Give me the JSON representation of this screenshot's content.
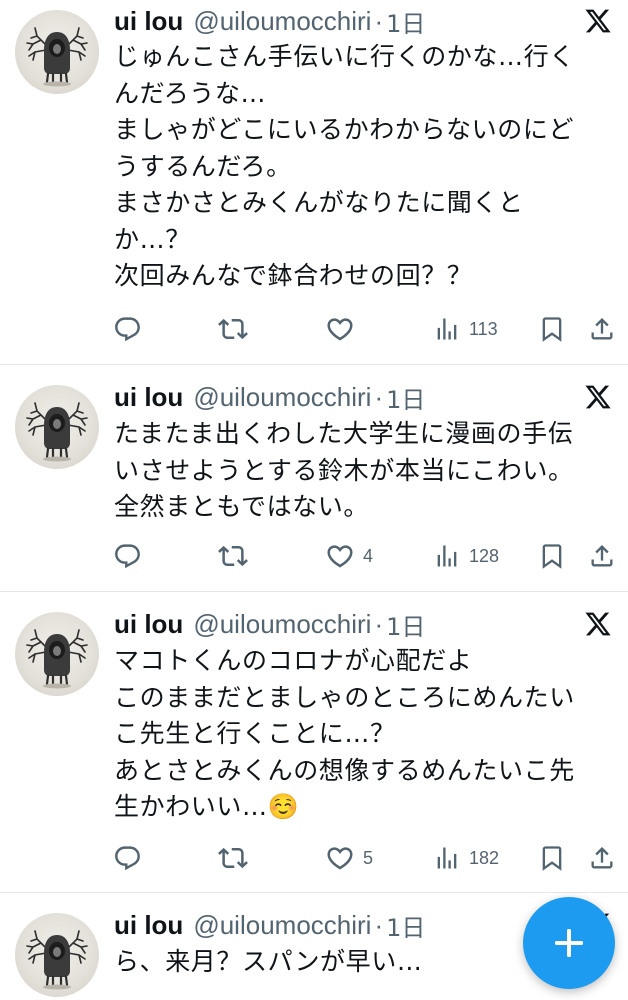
{
  "tweets": [
    {
      "name": "ui lou",
      "handle": "@uiloumocchiri",
      "time": "1日",
      "lines": [
        "じゅんこさん手伝いに行くのかな…行く",
        "んだろうな…",
        "ましゃがどこにいるかわからないのにど",
        "うするんだろ。",
        "まさかさとみくんがなりたに聞くと",
        "か…？",
        "次回みんなで鉢合わせの回？？"
      ],
      "likes": "",
      "views": "113"
    },
    {
      "name": "ui lou",
      "handle": "@uiloumocchiri",
      "time": "1日",
      "lines": [
        "たまたま出くわした大学生に漫画の手伝",
        "いさせようとする鈴木が本当にこわい。",
        "全然まともではない。"
      ],
      "likes": "4",
      "views": "128"
    },
    {
      "name": "ui lou",
      "handle": "@uiloumocchiri",
      "time": "1日",
      "lines": [
        "マコトくんのコロナが心配だよ",
        "このままだとましゃのところにめんたい",
        "こ先生と行くことに…？",
        "あとさとみくんの想像するめんたいこ先",
        "生かわいい…☺️"
      ],
      "likes": "5",
      "views": "182"
    },
    {
      "name": "ui lou",
      "handle": "@uiloumocchiri",
      "time": "1日",
      "lines": [
        "ら、来月？スパンが早い…"
      ]
    }
  ],
  "icons": {
    "reply": "reply-icon",
    "retweet": "retweet-icon",
    "like": "heart-icon",
    "views": "views-icon",
    "bookmark": "bookmark-icon",
    "share": "share-icon",
    "platform": "x-logo-icon",
    "compose": "plus-icon"
  },
  "colors": {
    "primary_text": "#0f1419",
    "secondary_text": "#536471",
    "accent": "#1d9bf0",
    "divider": "#e6e6e6"
  }
}
